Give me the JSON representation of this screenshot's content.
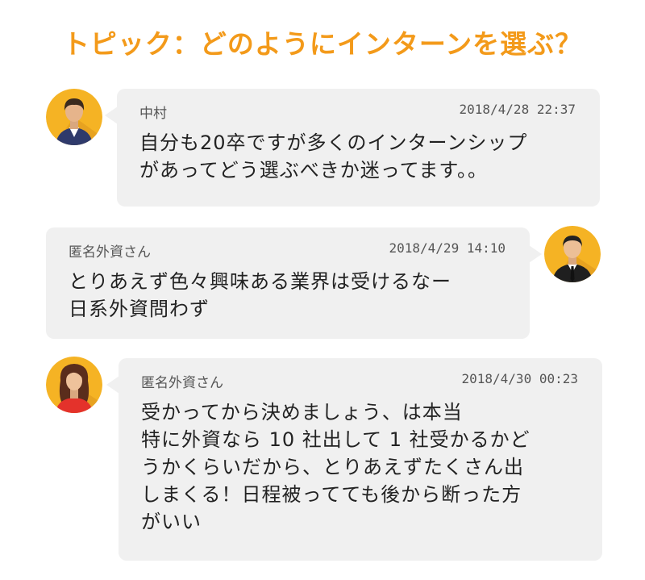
{
  "header": {
    "title": "トピック：どのようにインターンを選ぶ？"
  },
  "colors": {
    "accent": "#f39a1a",
    "bubble": "#f0f0f0",
    "avatar_bg": "#f5b324"
  },
  "messages": [
    {
      "author": "中村",
      "timestamp": "2018/4/28 22:37",
      "lines": [
        "自分も20卒ですが多くのインターンシップ",
        "があってどう選ぶべきか迷ってます。。"
      ],
      "avatar_icon": "male-student-avatar-icon"
    },
    {
      "author": "匿名外資さん",
      "timestamp": "2018/4/29 14:10",
      "lines": [
        "とりあえず色々興味ある業界は受けるなー",
        "日系外資問わず"
      ],
      "avatar_icon": "businessman-avatar-icon"
    },
    {
      "author": "匿名外資さん",
      "timestamp": "2018/4/30 00:23",
      "lines": [
        "受かってから決めましょう、は本当",
        "特に外資なら 10 社出して 1 社受かるかど",
        "うかくらいだから、とりあえずたくさん出",
        "しまくる！日程被ってても後から断った方",
        "がいい"
      ],
      "avatar_icon": "female-avatar-icon"
    }
  ]
}
